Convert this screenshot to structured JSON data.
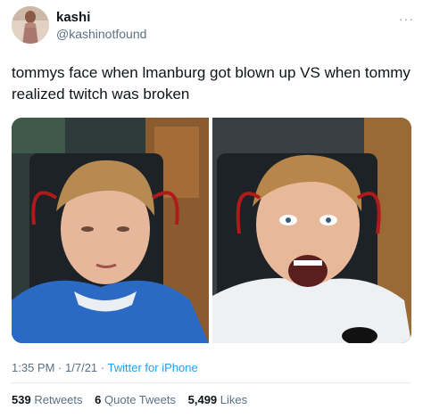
{
  "user": {
    "display_name": "kashi",
    "handle": "@kashinotfound"
  },
  "menu_icon": "more-horizontal-icon",
  "tweet": {
    "text": "tommys face when lmanburg got blown up VS when tommy realized twitch was broken"
  },
  "media": {
    "panels": [
      "left-photo",
      "right-photo"
    ]
  },
  "meta": {
    "time": "1:35 PM",
    "separator1": "·",
    "date": "1/7/21",
    "separator2": "·",
    "source": "Twitter for iPhone"
  },
  "stats": {
    "retweets_count": "539",
    "retweets_label": "Retweets",
    "quotes_count": "6",
    "quotes_label": "Quote Tweets",
    "likes_count": "5,499",
    "likes_label": "Likes"
  },
  "colors": {
    "link": "#1da1f2",
    "secondary_text": "#5b7083",
    "primary_text": "#0f1419"
  }
}
